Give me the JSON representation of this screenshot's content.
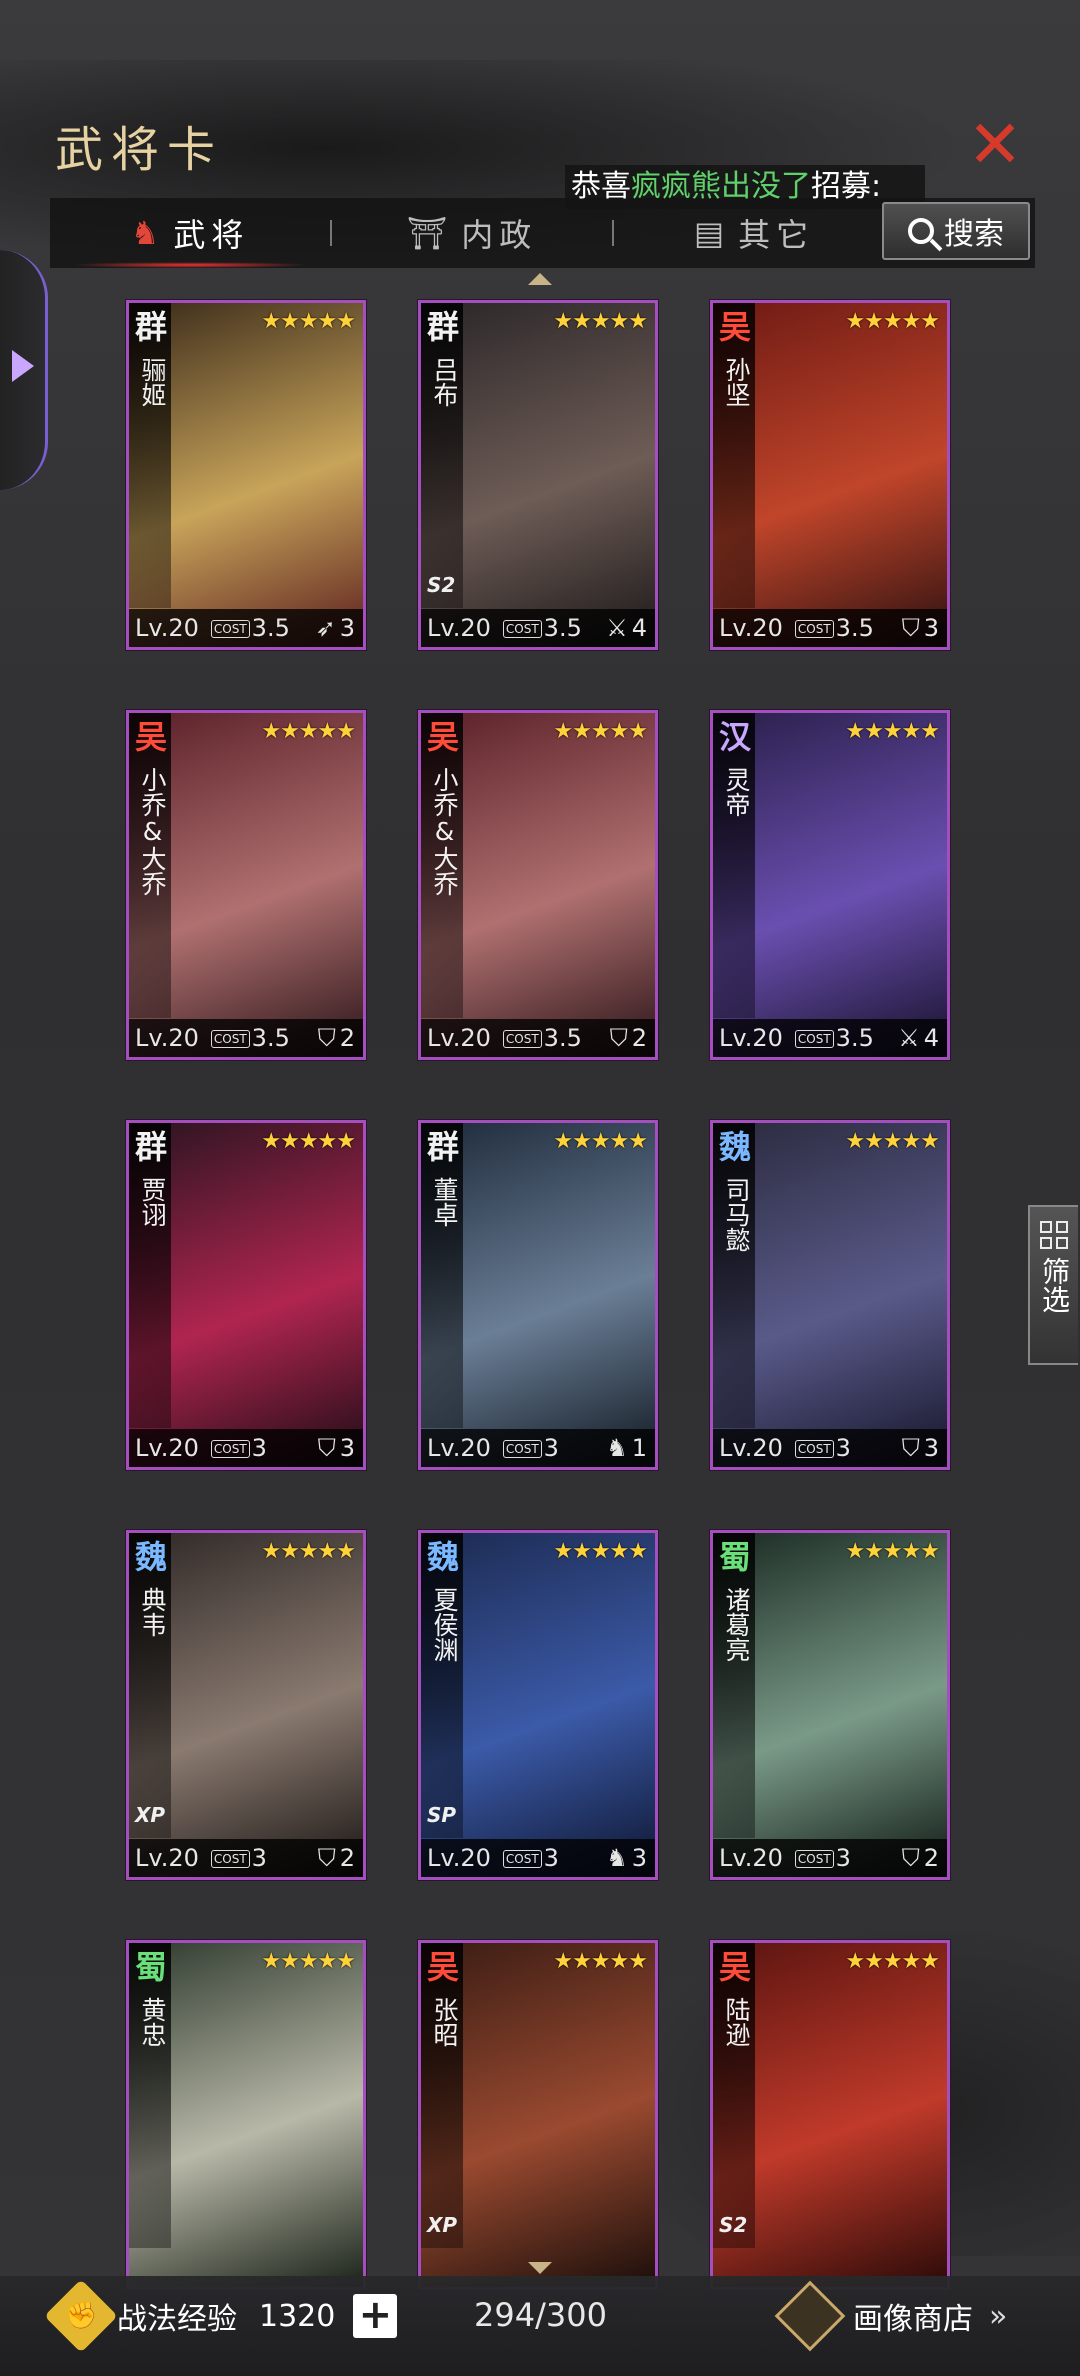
{
  "header": {
    "title": "武将卡",
    "close_icon": "close-icon",
    "marquee": {
      "prefix": "恭喜",
      "highlight": "疯疯熊出没了",
      "suffix": "招募:"
    }
  },
  "tabs": [
    {
      "label": "武将",
      "icon": "helmet-icon",
      "active": true
    },
    {
      "label": "内政",
      "icon": "pavilion-icon",
      "active": false
    },
    {
      "label": "其它",
      "icon": "stack-icon",
      "active": false
    }
  ],
  "search": {
    "label": "搜索"
  },
  "filter": {
    "label": "筛选"
  },
  "cards": [
    {
      "faction": "群",
      "faction_color": "#f2f2f2",
      "name": "骊姬",
      "stars": "★★★★★",
      "level": "Lv.20",
      "cost": "3.5",
      "count": "3",
      "troop": "bow-icon",
      "xp": "",
      "art": [
        "#3a2a1a",
        "#c8a45a",
        "#5a1e1e"
      ]
    },
    {
      "faction": "群",
      "faction_color": "#f2f2f2",
      "name": "吕布",
      "stars": "★★★★★",
      "level": "Lv.20",
      "cost": "3.5",
      "count": "4",
      "troop": "spear-icon",
      "xp": "S2",
      "art": [
        "#2a2628",
        "#6e5c56",
        "#1a1818"
      ]
    },
    {
      "faction": "吴",
      "faction_color": "#ff4b3a",
      "name": "孙坚",
      "stars": "★★★★★",
      "level": "Lv.20",
      "cost": "3.5",
      "count": "3",
      "troop": "shield-icon",
      "xp": "",
      "art": [
        "#6e1a14",
        "#c0452a",
        "#2a1010"
      ]
    },
    {
      "faction": "吴",
      "faction_color": "#ff4b3a",
      "name": "小乔&大乔",
      "stars": "★★★★★",
      "level": "Lv.20",
      "cost": "3.5",
      "count": "2",
      "troop": "shield-icon",
      "xp": "",
      "art": [
        "#5a2028",
        "#b07070",
        "#2a1418"
      ]
    },
    {
      "faction": "吴",
      "faction_color": "#ff4b3a",
      "name": "小乔&大乔",
      "stars": "★★★★★",
      "level": "Lv.20",
      "cost": "3.5",
      "count": "2",
      "troop": "shield-icon",
      "xp": "",
      "art": [
        "#5a2028",
        "#b07070",
        "#2a1418"
      ]
    },
    {
      "faction": "汉",
      "faction_color": "#c9a7ff",
      "name": "灵帝",
      "stars": "★★★★★",
      "level": "Lv.20",
      "cost": "3.5",
      "count": "4",
      "troop": "spear-icon",
      "xp": "",
      "art": [
        "#2a1f4a",
        "#6a4fb0",
        "#17112a"
      ]
    },
    {
      "faction": "群",
      "faction_color": "#f2f2f2",
      "name": "贾诩",
      "stars": "★★★★★",
      "level": "Lv.20",
      "cost": "3",
      "count": "3",
      "troop": "shield-icon",
      "xp": "",
      "art": [
        "#2a1420",
        "#b02550",
        "#1a0c14"
      ]
    },
    {
      "faction": "群",
      "faction_color": "#f2f2f2",
      "name": "董卓",
      "stars": "★★★★★",
      "level": "Lv.20",
      "cost": "3",
      "count": "1",
      "troop": "horse-icon",
      "xp": "",
      "art": [
        "#1e2a3a",
        "#6a7e96",
        "#101820"
      ]
    },
    {
      "faction": "魏",
      "faction_color": "#7ab8ff",
      "name": "司马懿",
      "stars": "★★★★★",
      "level": "Lv.20",
      "cost": "3",
      "count": "3",
      "troop": "shield-icon",
      "xp": "",
      "art": [
        "#2a2a3e",
        "#5a5a8a",
        "#15152a"
      ]
    },
    {
      "faction": "魏",
      "faction_color": "#7ab8ff",
      "name": "典韦",
      "stars": "★★★★★",
      "level": "Lv.20",
      "cost": "3",
      "count": "2",
      "troop": "shield-icon",
      "xp": "XP",
      "art": [
        "#2e2826",
        "#8a7a70",
        "#181412"
      ]
    },
    {
      "faction": "魏",
      "faction_color": "#7ab8ff",
      "name": "夏侯渊",
      "stars": "★★★★★",
      "level": "Lv.20",
      "cost": "3",
      "count": "3",
      "troop": "horse-icon",
      "xp": "SP",
      "art": [
        "#1c2a50",
        "#3b5aa8",
        "#0e1630"
      ]
    },
    {
      "faction": "蜀",
      "faction_color": "#6ae07a",
      "name": "诸葛亮",
      "stars": "★★★★★",
      "level": "Lv.20",
      "cost": "3",
      "count": "2",
      "troop": "shield-icon",
      "xp": "",
      "art": [
        "#1a2a22",
        "#7a9a88",
        "#0e1812"
      ]
    },
    {
      "faction": "蜀",
      "faction_color": "#6ae07a",
      "name": "黄忠",
      "stars": "★★★★★",
      "level": "Lv.20",
      "cost": "",
      "count": "",
      "troop": "",
      "xp": "",
      "art": [
        "#2e3a2e",
        "#b8b8a8",
        "#1a2218"
      ]
    },
    {
      "faction": "吴",
      "faction_color": "#ff4b3a",
      "name": "张昭",
      "stars": "★★★★★",
      "level": "Lv.20",
      "cost": "",
      "count": "",
      "troop": "",
      "xp": "XP",
      "art": [
        "#3a1c14",
        "#9a4a30",
        "#1a0e0a"
      ]
    },
    {
      "faction": "吴",
      "faction_color": "#ff4b3a",
      "name": "陆逊",
      "stars": "★★★★★",
      "level": "Lv.20",
      "cost": "",
      "count": "",
      "troop": "",
      "xp": "S2",
      "art": [
        "#5a1410",
        "#c03a2a",
        "#2a0a08"
      ]
    }
  ],
  "bottom": {
    "exp_label": "战法经验",
    "exp_value": "1320",
    "plus_label": "+",
    "total": "294/300",
    "shop_label": "画像商店",
    "shop_arrow": "»"
  },
  "colors": {
    "card_border": "#a54fbf",
    "accent_red": "#d63a2a",
    "title_gold": "#e7d2a2"
  }
}
